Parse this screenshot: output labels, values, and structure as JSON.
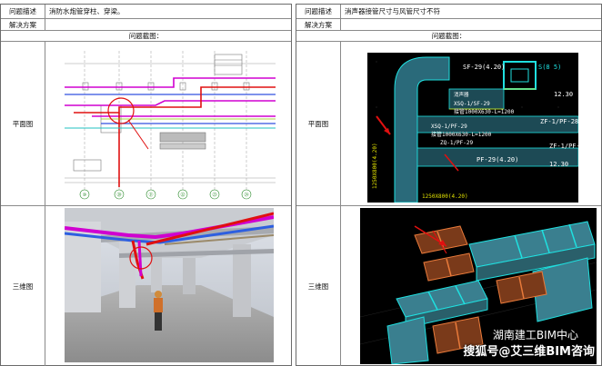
{
  "left": {
    "problem_label": "问题描述",
    "problem_text": "消防水炮管穿柱、穿梁。",
    "solution_label": "解决方案",
    "solution_text": "",
    "screenshot_header": "问题截图：",
    "plan_label": "平面图",
    "view3d_label": "三维图",
    "grid_labels": [
      "⑩",
      "⑳",
      "㉑",
      "㉒",
      "㉓",
      "㉔"
    ]
  },
  "right": {
    "problem_label": "问题描述",
    "problem_text": "消声器接管尺寸与风管尺寸不符",
    "solution_label": "解决方案",
    "solution_text": "",
    "screenshot_header": "问题截图：",
    "plan_label": "平面图",
    "view3d_label": "三维图",
    "cad_texts": {
      "t1": "SF-29(4.20)",
      "t2": "S(8 5)",
      "t3": "消声器",
      "t4": "XSQ-1/SF-29",
      "t5": "接管1000X630-L=1200",
      "t6": "XSQ-1/PF-29",
      "t7": "接管1000X630-L=1200",
      "t8": "ZQ-1/PF-29",
      "t9": "PF-29(4.20)",
      "t10": "1250X800(4.20)",
      "t11": "12.30",
      "t12": "ZF-1/PF-28",
      "t13": "ZF-1/PF-",
      "t14": "12.30",
      "t15": "1250X800(4.20)"
    }
  },
  "watermark": {
    "line1": "湖南建工BIM中心",
    "line2": "搜狐号@艾三维BIM咨询"
  },
  "colors": {
    "border": "#6b6b6b",
    "cad_bg": "#000000",
    "duct_cyan": "#1fe0e0",
    "pipe_magenta": "#d000d0",
    "pipe_red": "#e01010",
    "duct_orange": "#e87a3a"
  }
}
